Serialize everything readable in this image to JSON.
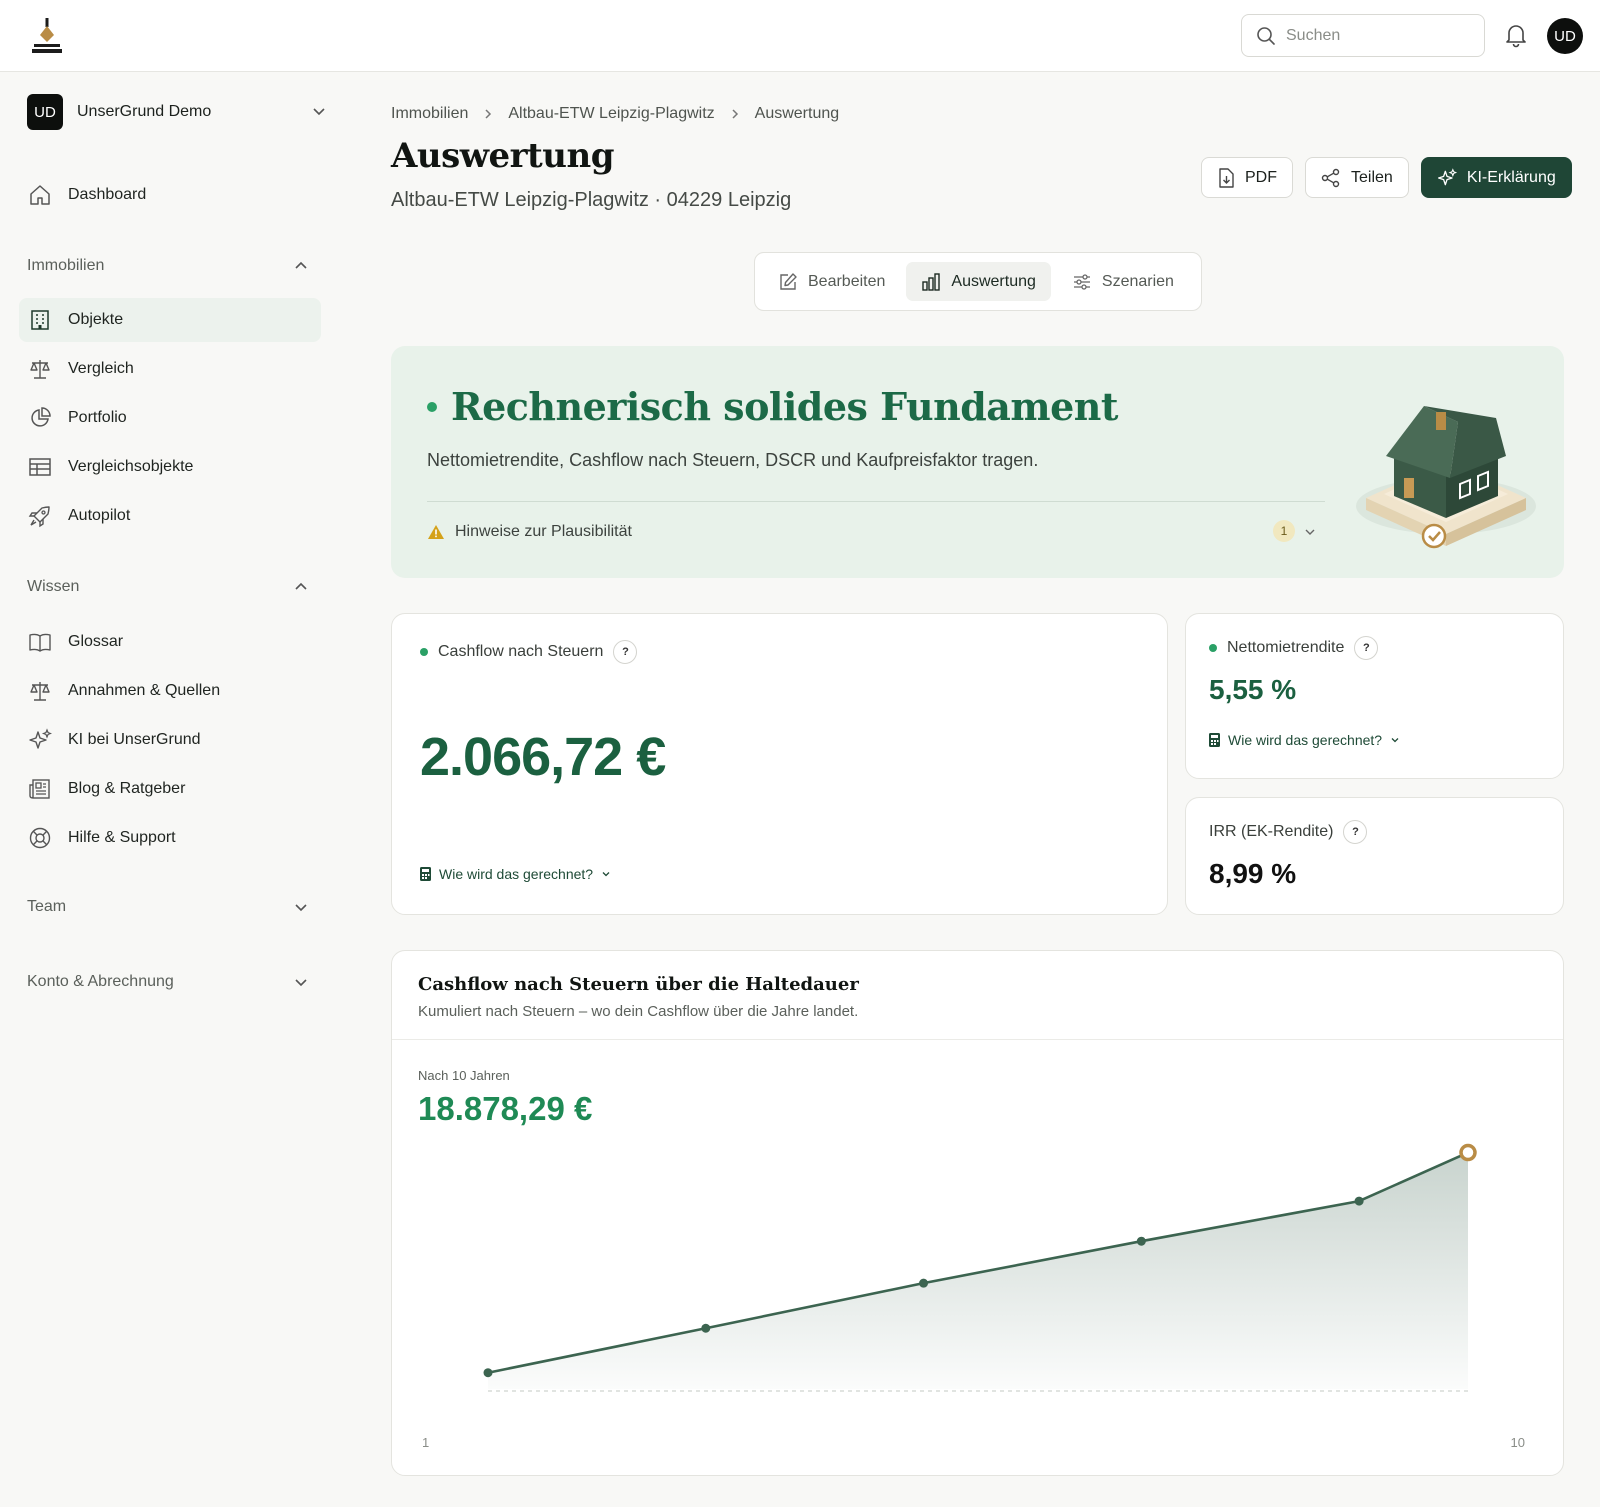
{
  "topbar": {
    "search_placeholder": "Suchen",
    "avatar_initials": "UD"
  },
  "sidebar": {
    "org_initials": "UD",
    "org_name": "UnserGrund Demo",
    "dashboard": "Dashboard",
    "sections": {
      "immobilien": "Immobilien",
      "wissen": "Wissen",
      "team": "Team",
      "konto": "Konto & Abrechnung"
    },
    "immobilien_items": [
      "Objekte",
      "Vergleich",
      "Portfolio",
      "Vergleichsobjekte",
      "Autopilot"
    ],
    "wissen_items": [
      "Glossar",
      "Annahmen & Quellen",
      "KI bei UnserGrund",
      "Blog & Ratgeber",
      "Hilfe & Support"
    ]
  },
  "breadcrumb": [
    "Immobilien",
    "Altbau-ETW Leipzig-Plagwitz",
    "Auswertung"
  ],
  "page": {
    "title": "Auswertung",
    "subtitle": "Altbau-ETW Leipzig-Plagwitz · 04229 Leipzig"
  },
  "actions": {
    "pdf": "PDF",
    "share": "Teilen",
    "ai": "KI-Erklärung"
  },
  "tabs": [
    "Bearbeiten",
    "Auswertung",
    "Szenarien"
  ],
  "hero": {
    "title": "Rechnerisch solides Fundament",
    "description": "Nettomietrendite, Cashflow nach Steuern, DSCR und Kaufpreisfaktor tragen.",
    "hint": "Hinweise zur Plausibilität",
    "hint_count": "1"
  },
  "kpis": {
    "cashflow": {
      "label": "Cashflow nach Steuern",
      "value": "2.066,72 €",
      "how": "Wie wird das gerechnet?"
    },
    "net_yield": {
      "label": "Nettomietrendite",
      "value": "5,55 %",
      "how": "Wie wird das gerechnet?"
    },
    "irr": {
      "label": "IRR (EK-Rendite)",
      "value": "8,99 %"
    },
    "help_mark": "?"
  },
  "chart": {
    "title": "Cashflow nach Steuern über die Haltedauer",
    "subtitle": "Kumuliert nach Steuern – wo dein Cashflow über die Jahre landet.",
    "summary_label": "Nach 10 Jahren",
    "summary_value": "18.878,29 €"
  },
  "chart_data": {
    "type": "area",
    "title": "Cashflow nach Steuern über die Haltedauer",
    "x": [
      1,
      3,
      5,
      7,
      9,
      10
    ],
    "values": [
      1300,
      4850,
      8450,
      11800,
      15000,
      18878.29
    ],
    "x_tick_labels": [
      "1",
      "10"
    ],
    "xlim": [
      1,
      10
    ],
    "ylim": [
      0,
      19000
    ],
    "grid": false,
    "line_color": "#3c6450",
    "highlight_color": "#b98c46"
  },
  "colors": {
    "accent": "#1f4636",
    "positive": "#1b6040",
    "hero_bg": "#e8f2ea"
  }
}
